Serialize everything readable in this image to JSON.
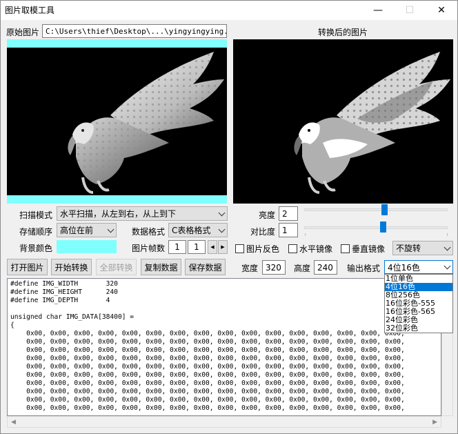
{
  "window": {
    "title": "图片取模工具",
    "min_glyph": "—",
    "max_glyph": "☐",
    "close_glyph": "✕"
  },
  "original": {
    "label": "原始图片",
    "path": "C:\\Users\\thief\\Desktop\\...\\yingyingying.jpg"
  },
  "converted": {
    "label": "转换后的图片"
  },
  "scan_mode": {
    "label": "扫描模式",
    "value": "水平扫描，从左到右，从上到下"
  },
  "storage_order": {
    "label": "存储顺序",
    "value": "高位在前"
  },
  "data_format": {
    "label": "数据格式",
    "value": "C表格格式"
  },
  "bg_color": {
    "label": "背景颜色",
    "color": "#80ffff"
  },
  "frames": {
    "label": "图片帧数",
    "current": "1",
    "total": "1",
    "prev_glyph": "◀",
    "next_glyph": "▶"
  },
  "brightness": {
    "label": "亮度",
    "value": "2",
    "level": 0.56
  },
  "contrast": {
    "label": "对比度",
    "value": "1",
    "level": 0.55
  },
  "options": {
    "invert_label": "图片反色",
    "hmirror_label": "水平镜像",
    "vmirror_label": "垂直镜像",
    "rotate_value": "不旋转"
  },
  "buttons": {
    "open": "打开图片",
    "convert": "开始转换",
    "convert_all": "全部转换",
    "copy": "复制数据",
    "save": "保存数据"
  },
  "size": {
    "width_label": "宽度",
    "width_value": "320",
    "height_label": "高度",
    "height_value": "240"
  },
  "output_format": {
    "label": "输出格式",
    "value": "4位16色",
    "options": [
      "1位单色",
      "4位16色",
      "8位256色",
      "16位彩色-555",
      "16位彩色-565",
      "24位彩色",
      "32位彩色"
    ],
    "selected_index": 1
  },
  "code": {
    "header_lines": [
      "#define IMG_WIDTH       320",
      "#define IMG_HEIGHT      240",
      "#define IMG_DEPTH       4",
      "",
      "unsigned char IMG_DATA[38400] =",
      "{"
    ],
    "data_line": "    0x00, 0x00, 0x00, 0x00, 0x00, 0x00, 0x00, 0x00, 0x00, 0x00, 0x00, 0x00, 0x00, 0x00, 0x00, 0x00,",
    "data_line_count": 10
  },
  "colors": {
    "accent": "#0078d7",
    "slider_thumb": "#007ad9",
    "bg_cyan": "#80ffff"
  }
}
